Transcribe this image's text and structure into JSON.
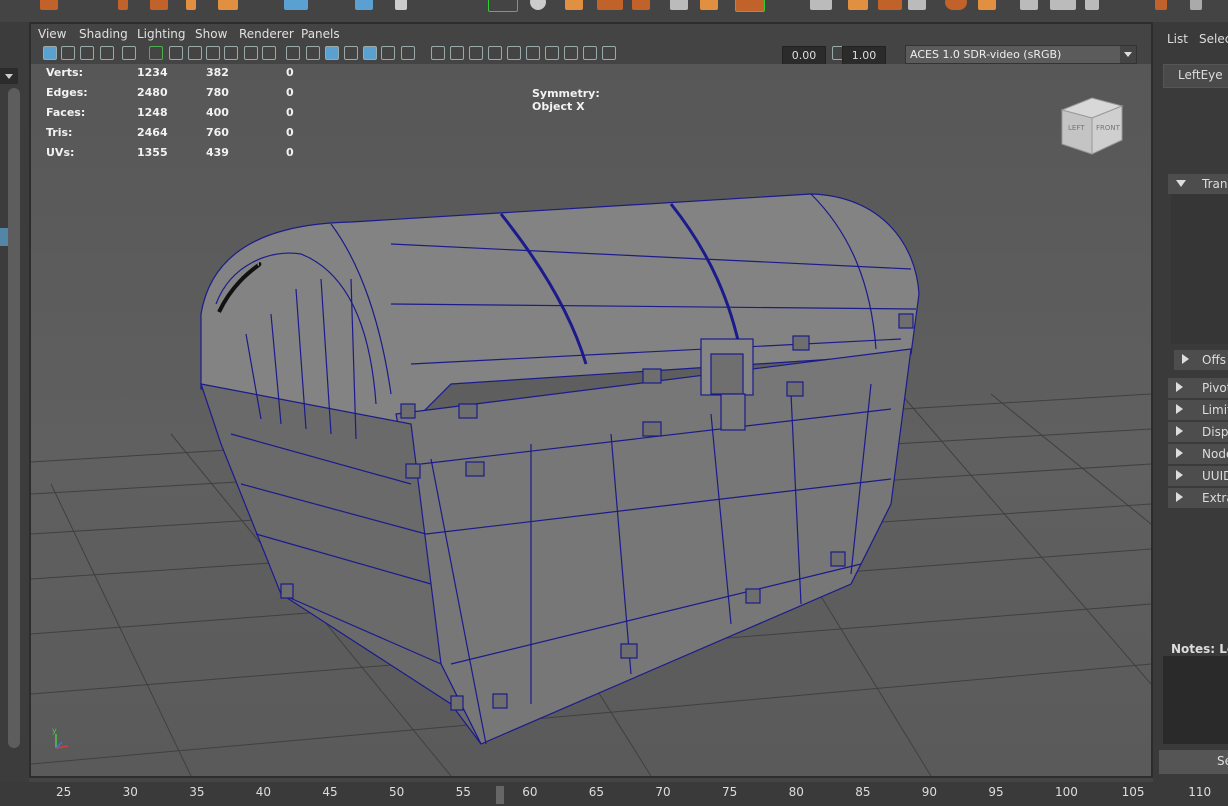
{
  "panel_menu": {
    "view": "View",
    "shading": "Shading",
    "lighting": "Lighting",
    "show": "Show",
    "renderer": "Renderer",
    "panels": "Panels"
  },
  "toolbar": {
    "exposure_value": "0.00",
    "gamma_value": "1.00",
    "color_space": "ACES 1.0 SDR-video (sRGB)",
    "icons": [
      "select-camera-icon",
      "camera-attributes-icon",
      "bookmark-icon",
      "image-plane-icon",
      "2d-pan-icon",
      "grease-pencil-icon",
      "grid-icon",
      "film-gate-icon",
      "resolution-gate-icon",
      "gate-mask-icon",
      "field-chart-icon",
      "safe-action-icon",
      "safe-title-icon",
      "wireframe-icon",
      "smooth-shade-icon",
      "default-material-icon",
      "wireframe-on-shaded-icon",
      "textured-icon",
      "lights-icon",
      "shadows-icon",
      "ambient-occlusion-icon",
      "motion-blur-icon",
      "anti-aliasing-icon",
      "depth-of-field-icon",
      "isolate-select-icon",
      "xray-icon",
      "xray-joints-icon",
      "backface-culling-icon",
      "exposure-icon",
      "gamma-icon",
      "color-management-icon"
    ]
  },
  "hud": {
    "symmetry": "Symmetry: Object X",
    "rows": [
      {
        "label": "Verts:",
        "a": "1234",
        "b": "382",
        "c": "0"
      },
      {
        "label": "Edges:",
        "a": "2480",
        "b": "780",
        "c": "0"
      },
      {
        "label": "Faces:",
        "a": "1248",
        "b": "400",
        "c": "0"
      },
      {
        "label": "Tris:",
        "a": "2464",
        "b": "760",
        "c": "0"
      },
      {
        "label": "UVs:",
        "a": "1355",
        "b": "439",
        "c": "0"
      }
    ]
  },
  "view_cube": {
    "left": "LEFT",
    "front": "FRONT"
  },
  "axis": {
    "y": "y"
  },
  "attribute_editor": {
    "tabs": [
      "List",
      "Selec"
    ],
    "node_tab": "LeftEye",
    "sections": [
      "Trans",
      "Offs",
      "Pivot",
      "Limit",
      "Displ",
      "Node",
      "UUID",
      "Extra"
    ],
    "notes_label": "Notes: Lef",
    "bottom_button": "Se"
  },
  "timeline": {
    "ticks": [
      "25",
      "30",
      "35",
      "40",
      "45",
      "50",
      "55",
      "60",
      "65",
      "70",
      "75",
      "80",
      "85",
      "90",
      "95",
      "100",
      "105",
      "110"
    ],
    "current_frame_marker": "55"
  },
  "colors": {
    "wire": "#1b1b8c",
    "mesh_face": "#7c7c7c",
    "viewport_bg": "#5c5c5c",
    "grid": "#3e3e3e"
  }
}
